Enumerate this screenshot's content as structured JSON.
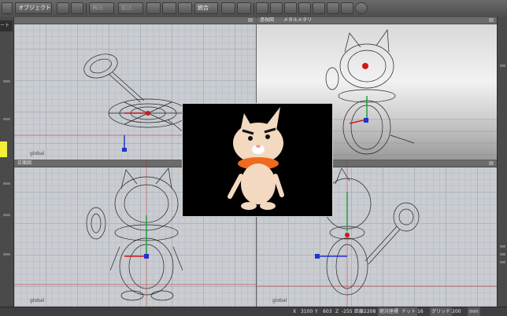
{
  "toolbar": {
    "object_button_label": "オブジェクト",
    "disabled_1": "再込",
    "disabled_2": "拡込",
    "combine_button_label": "統合"
  },
  "left_strip": {
    "tag": "ート"
  },
  "viewports": {
    "top_left": {
      "title": "",
      "coord_label": "global"
    },
    "top_right": {
      "title": "透視図",
      "tab_label": "メタルメタリ"
    },
    "bottom_left": {
      "title": "正面図",
      "coord_label": "global"
    },
    "bottom_right": {
      "title": "",
      "coord_label": "global"
    }
  },
  "status": {
    "x_label": "X",
    "x_value": "3100",
    "y_label": "Y",
    "y_value": "603",
    "z_label": "Z",
    "z_value": "-255",
    "distance_label": "距離",
    "distance_value": "2208",
    "snap_label": "絶対座標",
    "dot_label": "ドット",
    "dot_value": "16",
    "grid_label": "グリッド",
    "grid_value": "200",
    "unit": "mm"
  },
  "colors": {
    "accent_yellow": "#f1ef3a",
    "axis_red": "#cc1a1a",
    "axis_green": "#1f9e3a",
    "axis_blue": "#2233cc",
    "character_orange": "#ee6a1e",
    "character_body": "#f2d9bf"
  }
}
